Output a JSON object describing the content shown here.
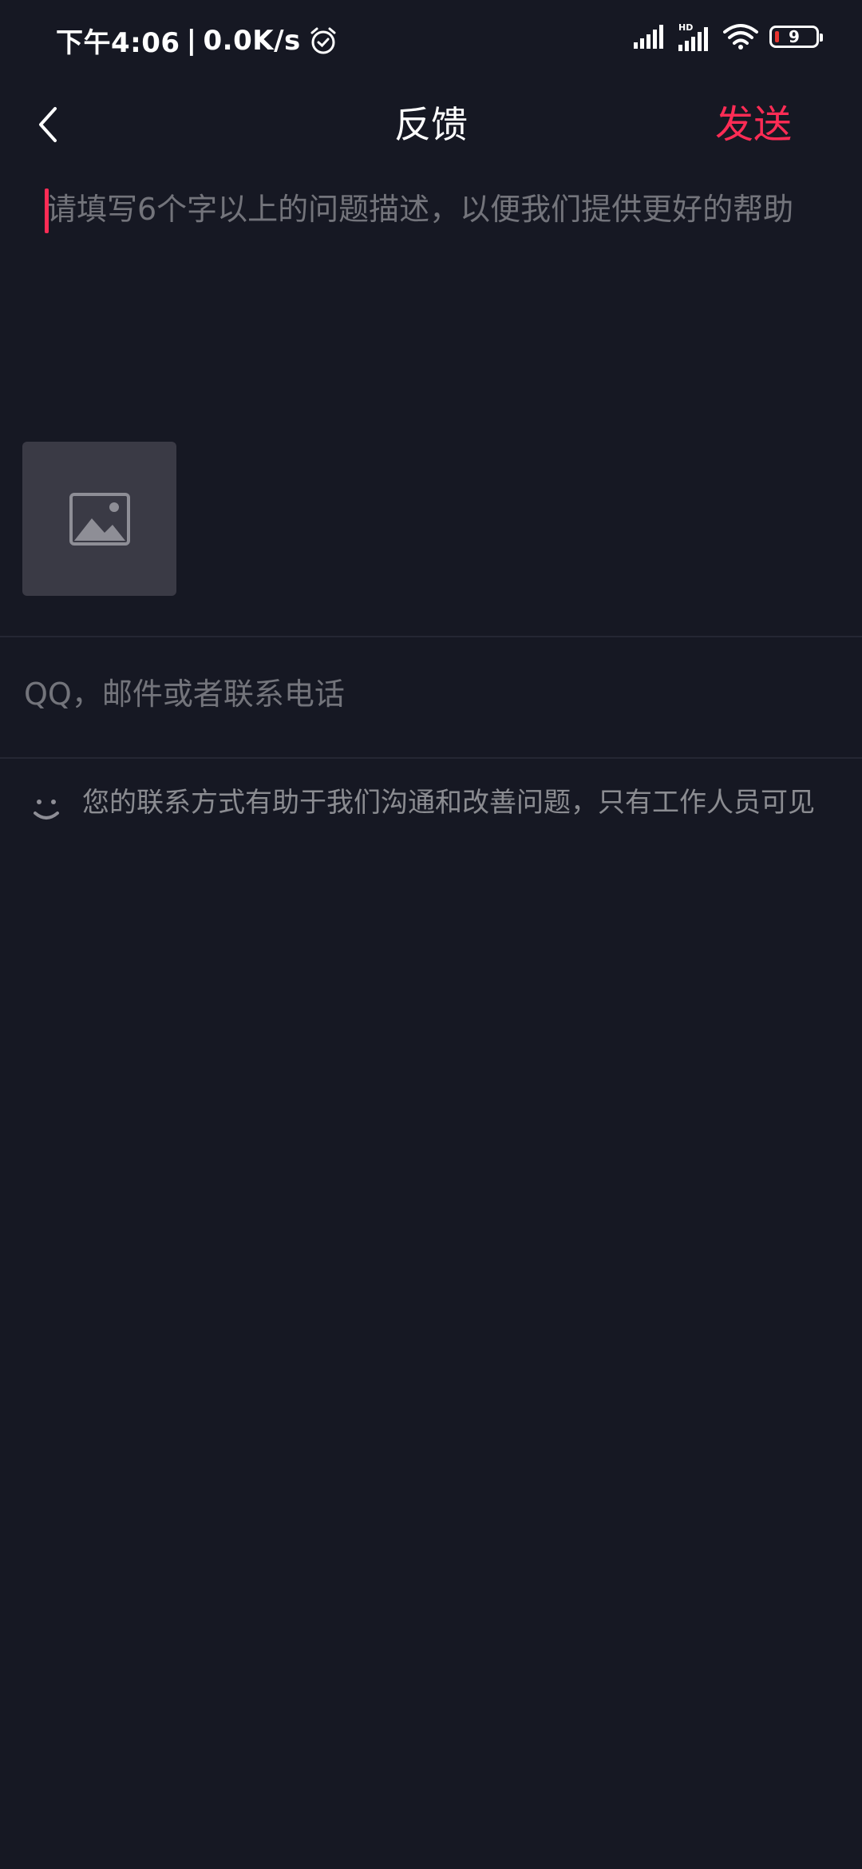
{
  "status_bar": {
    "time": "下午4:06",
    "separator": "|",
    "network_speed": "0.0K/s",
    "alarm_icon": "alarm-clock-icon",
    "signal_1_icon": "cell-signal-icon",
    "signal_2_icon": "cell-signal-hd-icon",
    "signal_2_badge": "HD",
    "wifi_icon": "wifi-icon",
    "battery_level": "9",
    "battery_color": "#e8342f"
  },
  "nav": {
    "back_icon": "chevron-left-icon",
    "title": "反馈",
    "send_label": "发送",
    "send_color": "#fe2c55"
  },
  "form": {
    "description_placeholder": "请填写6个字以上的问题描述，以便我们提供更好的帮助",
    "description_value": "",
    "image_icon": "image-placeholder-icon",
    "contact_placeholder": "QQ，邮件或者联系电话",
    "contact_value": ""
  },
  "hint": {
    "icon": "smile-icon",
    "text": "您的联系方式有助于我们沟通和改善问题，只有工作人员可见"
  },
  "colors": {
    "background": "#161823",
    "accent": "#fe2c55",
    "image_tile": "#3a3a45",
    "divider": "#252733"
  }
}
